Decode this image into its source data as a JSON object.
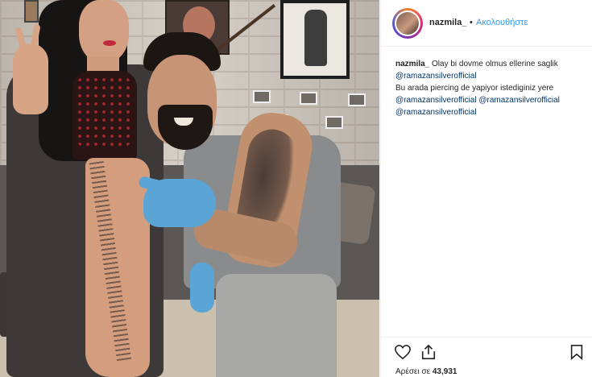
{
  "post": {
    "author": {
      "username": "nazmila_",
      "separator": "•",
      "follow_label": "Ακολουθήστε"
    },
    "caption": {
      "username": "nazmila_",
      "line1": " Olay bi dovme olmus ellerine saglik",
      "mention1": "@ramazansilverofficial",
      "line2": "Bu arada piercing de yapiyor istediginiz yere",
      "mention2": "@ramazansilverofficial",
      "mention3": "@ramazansilverofficial",
      "mention4": "@ramazansilverofficial"
    },
    "actions": {
      "like_icon": "heart-icon",
      "share_icon": "share-icon",
      "save_icon": "bookmark-icon"
    },
    "likes": {
      "label": "Αρέσει σε",
      "count": "43,931"
    }
  },
  "colors": {
    "link": "#3897f0",
    "mention": "#003569",
    "text": "#262626",
    "divider": "#efefef"
  }
}
